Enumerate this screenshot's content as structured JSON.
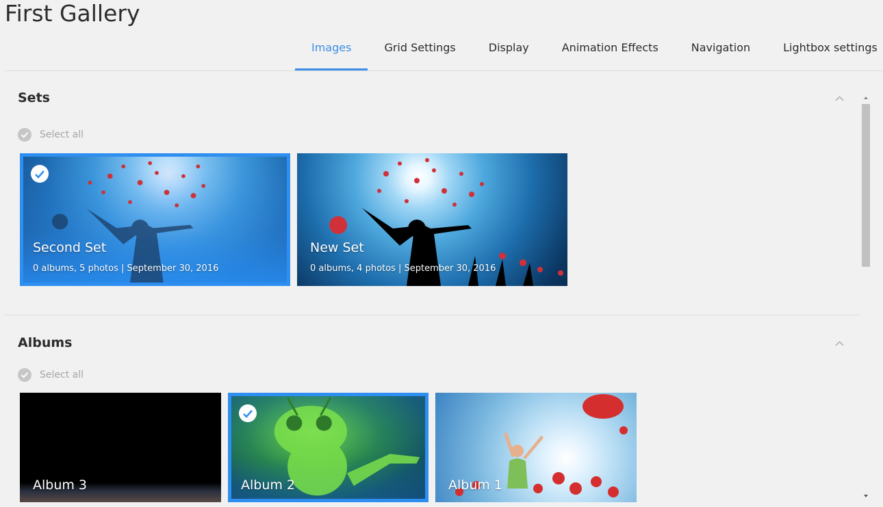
{
  "page": {
    "title": "First Gallery"
  },
  "tabs": [
    {
      "label": "Images",
      "active": true
    },
    {
      "label": "Grid Settings",
      "active": false
    },
    {
      "label": "Display",
      "active": false
    },
    {
      "label": "Animation Effects",
      "active": false
    },
    {
      "label": "Navigation",
      "active": false
    },
    {
      "label": "Lightbox settings",
      "active": false
    }
  ],
  "sets": {
    "title": "Sets",
    "select_all": "Select all",
    "items": [
      {
        "title": "Second Set",
        "meta": "0 albums, 5 photos | September 30, 2016",
        "selected": true
      },
      {
        "title": "New Set",
        "meta": "0 albums, 4 photos | September 30, 2016",
        "selected": false
      }
    ]
  },
  "albums": {
    "title": "Albums",
    "select_all": "Select all",
    "items": [
      {
        "title": "Album 3",
        "selected": false
      },
      {
        "title": "Album 2",
        "selected": true
      },
      {
        "title": "Album 1",
        "selected": false
      }
    ]
  },
  "icons": {
    "check": "check-icon",
    "collapse": "chevron-up-icon",
    "scroll_up": "arrow-up-icon",
    "scroll_down": "arrow-down-icon"
  },
  "colors": {
    "accent": "#3b8fe6",
    "selected_border": "#2f8ff0",
    "background": "#f1f1f1"
  }
}
